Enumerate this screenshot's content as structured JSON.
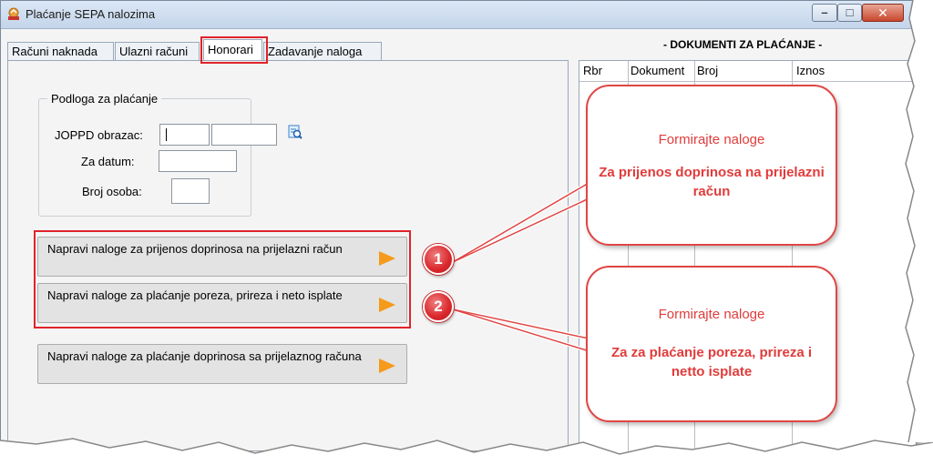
{
  "window": {
    "title": "Plaćanje SEPA nalozima",
    "controls": {
      "minimize": "–",
      "maximize": "□",
      "close": "✕"
    }
  },
  "tabs": [
    {
      "label": "Računi naknada",
      "active": false
    },
    {
      "label": "Ulazni računi",
      "active": false
    },
    {
      "label": "Honorari",
      "active": true
    },
    {
      "label": "Zadavanje naloga",
      "active": false
    }
  ],
  "group": {
    "legend": "Podloga za plaćanje",
    "joppd_label": "JOPPD obrazac:",
    "joppd_value_1": "",
    "joppd_value_2": "",
    "date_label": "Za datum:",
    "date_value": "",
    "persons_label": "Broj osoba:",
    "persons_value": ""
  },
  "buttons": [
    {
      "label": "Napravi naloge za prijenos doprinosa na prijelazni račun",
      "icon": "play-arrow-icon"
    },
    {
      "label": "Napravi naloge za plaćanje poreza, prireza i neto isplate",
      "icon": "play-arrow-icon"
    },
    {
      "label": "Napravi naloge za plaćanje doprinosa sa prijelaznog računa",
      "icon": "play-arrow-icon"
    }
  ],
  "badges": [
    "1",
    "2"
  ],
  "documents": {
    "title": "- DOKUMENTI ZA PLAĆANJE -",
    "columns": [
      "Rbr",
      "Dokument",
      "Broj",
      "Iznos"
    ]
  },
  "callouts": [
    {
      "line1": "Formirajte naloge",
      "line2": "Za prijenos doprinosa na prijelazni račun"
    },
    {
      "line1": "Formirajte naloge",
      "line2": "Za za plaćanje poreza, prireza i netto isplate"
    }
  ],
  "colors": {
    "highlight": "#e0232a",
    "callout_text": "#e03c3b",
    "arrow": "#f59a1b",
    "titlebar": "#c4d5ea"
  }
}
